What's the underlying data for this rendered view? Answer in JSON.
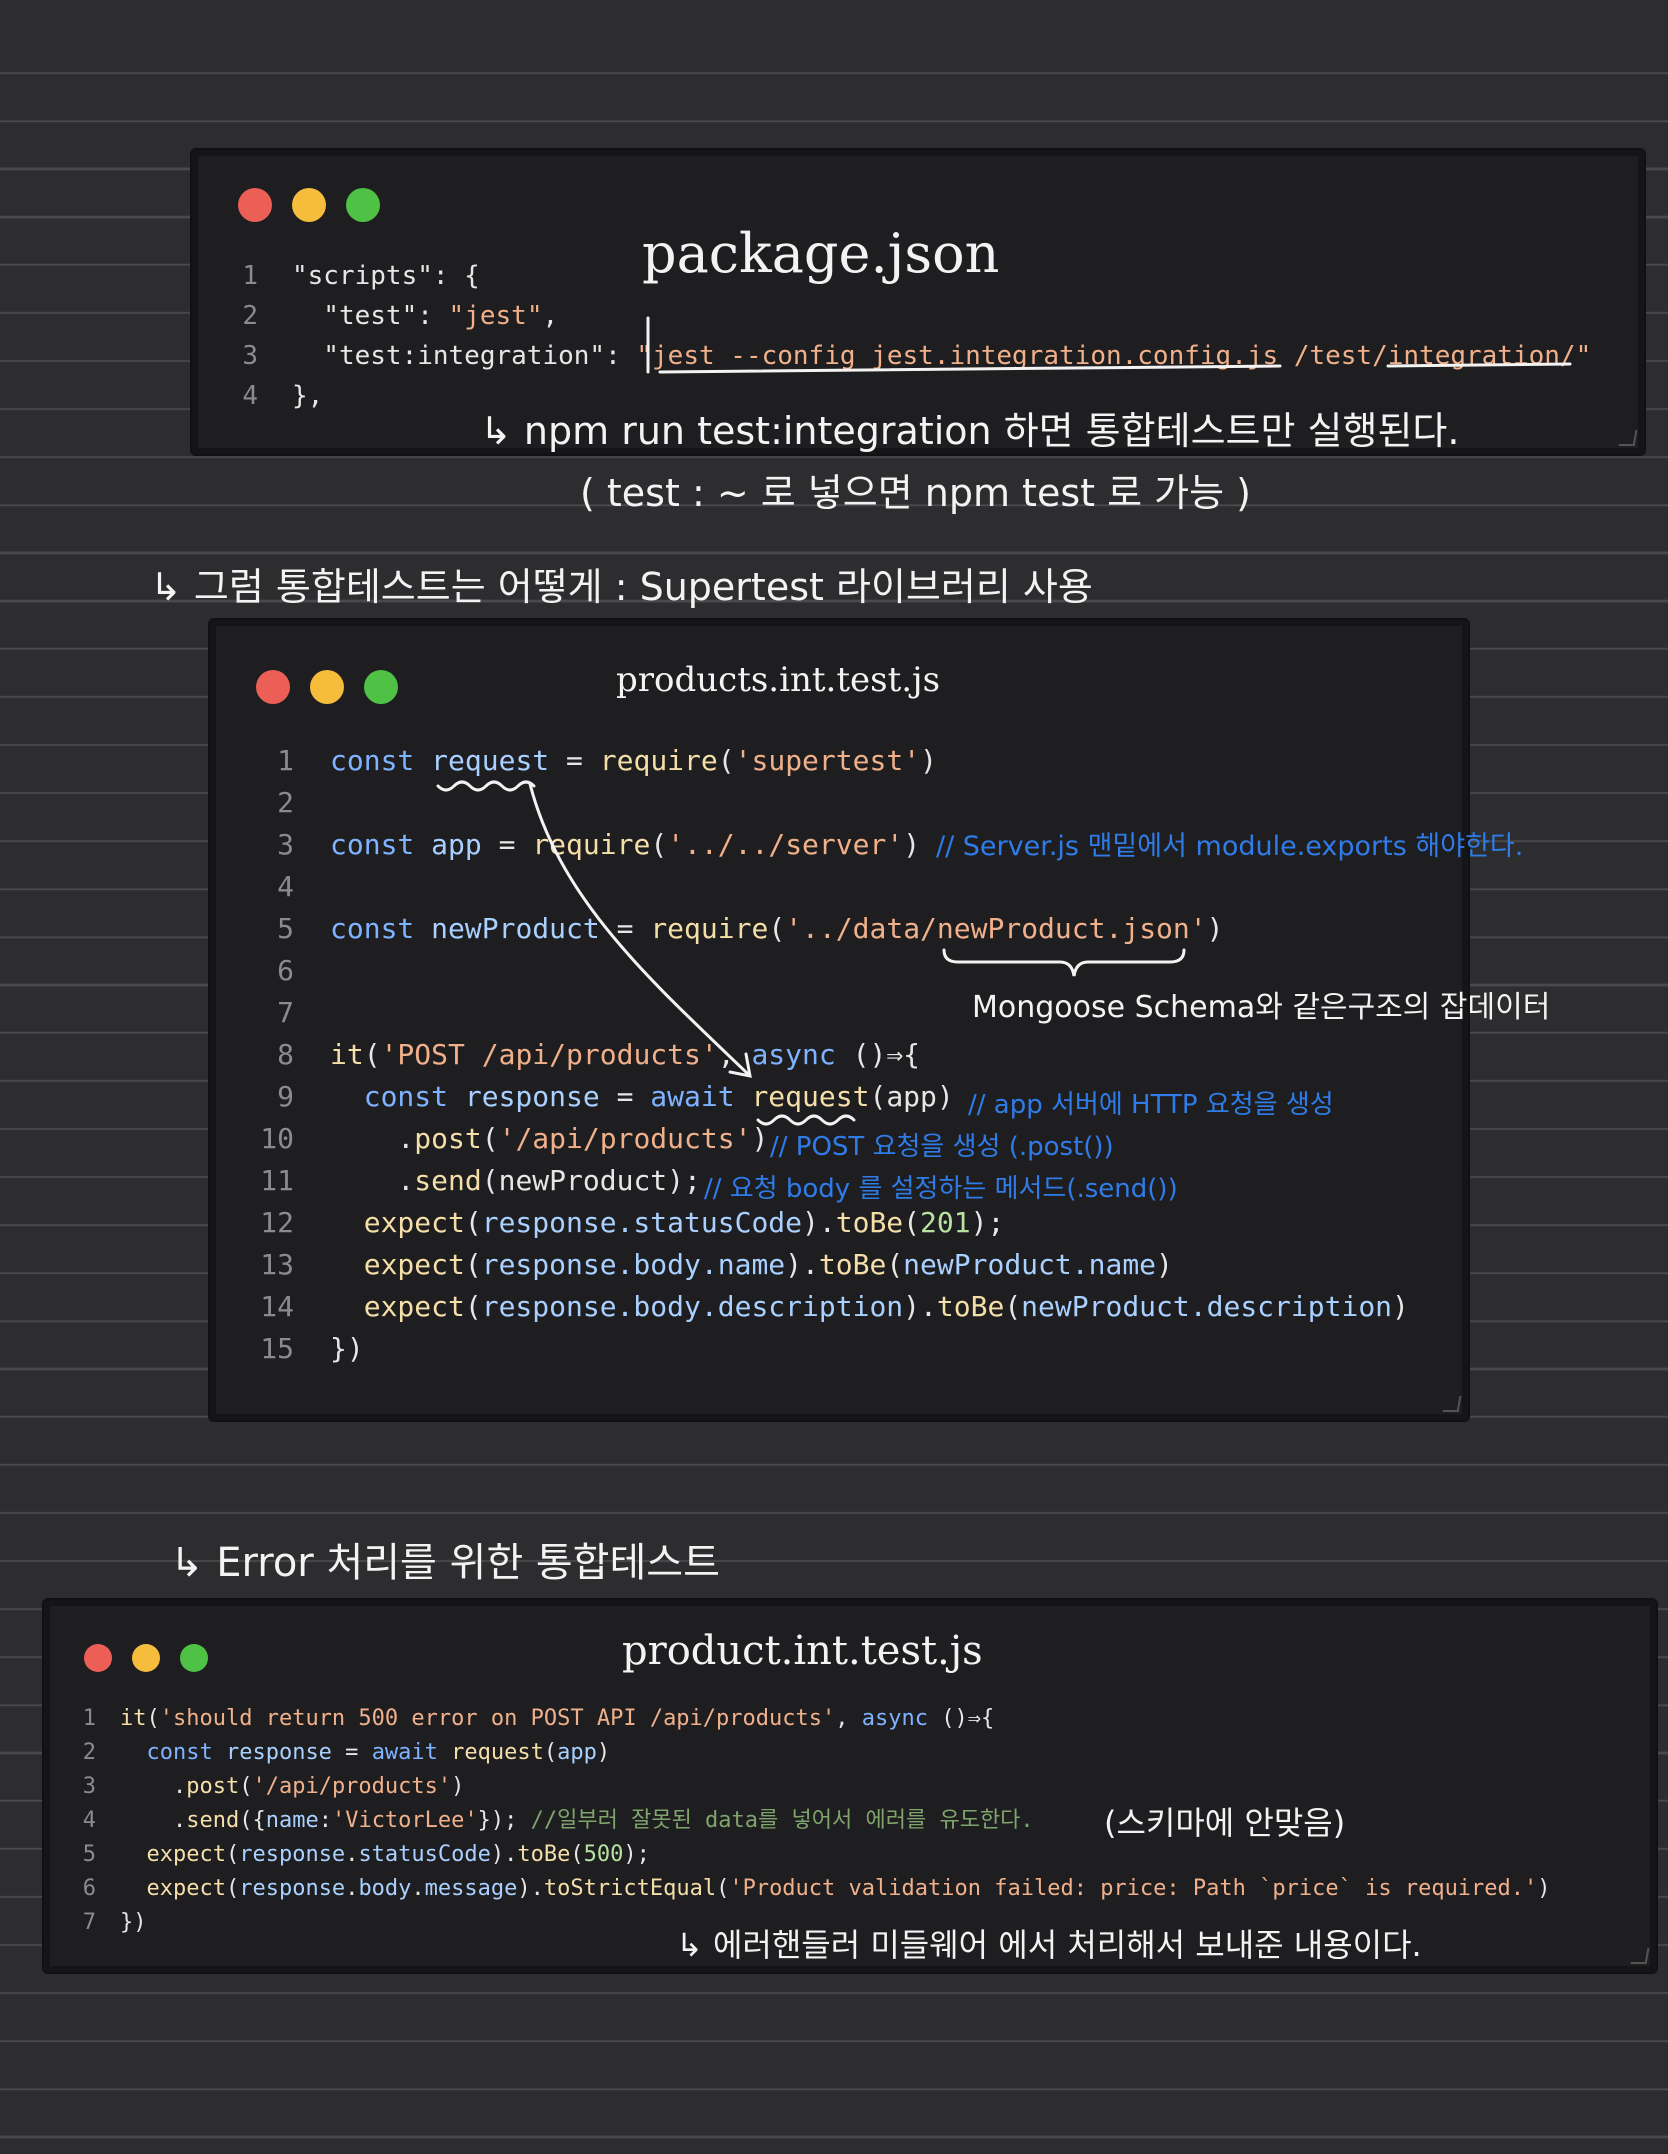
{
  "window1": {
    "title": "package.json",
    "lines": [
      {
        "n": "1",
        "parts": [
          [
            "pr",
            "\"scripts\": {"
          ]
        ]
      },
      {
        "n": "2",
        "parts": [
          [
            "pr",
            "  \"test\": "
          ],
          [
            "str",
            "\"jest\""
          ],
          [
            "pr",
            ","
          ]
        ]
      },
      {
        "n": "3",
        "parts": [
          [
            "pr",
            "  \"test:integration\": "
          ],
          [
            "str",
            "\"jest --config jest.integration.config.js /test/integration/\""
          ]
        ]
      },
      {
        "n": "4",
        "parts": [
          [
            "pr",
            "},"
          ]
        ]
      }
    ]
  },
  "note1": "↳ npm run test:integration   하면 통합테스트만 실행된다.",
  "note2": "( test : ~ 로 넣으면   npm test 로  가능 )",
  "note3": "↳  그럼 통합테스트는 어떻게  :  Supertest 라이브러리 사용",
  "window2": {
    "title": "products.int.test.js",
    "lines": [
      {
        "n": "1",
        "parts": [
          [
            "kw",
            "const "
          ],
          [
            "id",
            "request"
          ],
          [
            "pr",
            " = "
          ],
          [
            "fn",
            "require"
          ],
          [
            "pr",
            "("
          ],
          [
            "str",
            "'supertest'"
          ],
          [
            "pr",
            ")"
          ]
        ]
      },
      {
        "n": "2",
        "parts": []
      },
      {
        "n": "3",
        "parts": [
          [
            "kw",
            "const "
          ],
          [
            "id",
            "app"
          ],
          [
            "pr",
            " = "
          ],
          [
            "fn",
            "require"
          ],
          [
            "pr",
            "("
          ],
          [
            "str",
            "'../../server'"
          ],
          [
            "pr",
            ")"
          ]
        ]
      },
      {
        "n": "4",
        "parts": []
      },
      {
        "n": "5",
        "parts": [
          [
            "kw",
            "const "
          ],
          [
            "id",
            "newProduct"
          ],
          [
            "pr",
            " = "
          ],
          [
            "fn",
            "require"
          ],
          [
            "pr",
            "("
          ],
          [
            "str",
            "'../data/newProduct.json'"
          ],
          [
            "pr",
            ")"
          ]
        ]
      },
      {
        "n": "6",
        "parts": []
      },
      {
        "n": "7",
        "parts": []
      },
      {
        "n": "8",
        "parts": [
          [
            "fn",
            "it"
          ],
          [
            "pr",
            "("
          ],
          [
            "str",
            "'POST /api/products'"
          ],
          [
            "pr",
            ", "
          ],
          [
            "kw",
            "async "
          ],
          [
            "pr",
            "()⇒{"
          ]
        ]
      },
      {
        "n": "9",
        "parts": [
          [
            "kw",
            "  const "
          ],
          [
            "id",
            "response"
          ],
          [
            "pr",
            " = "
          ],
          [
            "kw",
            "await "
          ],
          [
            "fn",
            "request"
          ],
          [
            "pr",
            "(app)"
          ]
        ]
      },
      {
        "n": "10",
        "parts": [
          [
            "pr",
            "    ."
          ],
          [
            "fn",
            "post"
          ],
          [
            "pr",
            "("
          ],
          [
            "str",
            "'/api/products'"
          ],
          [
            "pr",
            ")"
          ]
        ]
      },
      {
        "n": "11",
        "parts": [
          [
            "pr",
            "    ."
          ],
          [
            "fn",
            "send"
          ],
          [
            "pr",
            "(newProduct);"
          ]
        ]
      },
      {
        "n": "12",
        "parts": [
          [
            "fn",
            "  expect"
          ],
          [
            "pr",
            "("
          ],
          [
            "id",
            "response.statusCode"
          ],
          [
            "pr",
            ")."
          ],
          [
            "fn",
            "toBe"
          ],
          [
            "pr",
            "("
          ],
          [
            "num",
            "201"
          ],
          [
            "pr",
            ");"
          ]
        ]
      },
      {
        "n": "13",
        "parts": [
          [
            "fn",
            "  expect"
          ],
          [
            "pr",
            "("
          ],
          [
            "id",
            "response.body.name"
          ],
          [
            "pr",
            ")."
          ],
          [
            "fn",
            "toBe"
          ],
          [
            "pr",
            "("
          ],
          [
            "id",
            "newProduct.name"
          ],
          [
            "pr",
            ")"
          ]
        ]
      },
      {
        "n": "14",
        "parts": [
          [
            "fn",
            "  expect"
          ],
          [
            "pr",
            "("
          ],
          [
            "id",
            "response.body.description"
          ],
          [
            "pr",
            ")."
          ],
          [
            "fn",
            "toBe"
          ],
          [
            "pr",
            "("
          ],
          [
            "id",
            "newProduct.description"
          ],
          [
            "pr",
            ")"
          ]
        ]
      },
      {
        "n": "15",
        "parts": [
          [
            "pr",
            "})"
          ]
        ]
      }
    ]
  },
  "comment_line3": "// Server.js 맨밑에서  module.exports 해야한다.",
  "note_schema": "Mongoose Schema와  같은구조의 잡데이터",
  "comment_line9": "// app 서버에  HTTP 요청을 생성",
  "comment_line10": "// POST 요청을 생성 (.post())",
  "comment_line11": "// 요청 body 를 설정하는 메서드(.send())",
  "note4": "↳ Error  처리를  위한   통합테스트",
  "window3": {
    "title": "product.int.test.js",
    "lines": [
      {
        "n": "1",
        "parts": [
          [
            "fn",
            "it"
          ],
          [
            "pr",
            "("
          ],
          [
            "str",
            "'should return 500 error on POST API /api/products'"
          ],
          [
            "pr",
            ", "
          ],
          [
            "kw",
            "async "
          ],
          [
            "pr",
            "()⇒{"
          ]
        ]
      },
      {
        "n": "2",
        "parts": [
          [
            "kw",
            "  const "
          ],
          [
            "id",
            "response"
          ],
          [
            "pr",
            " = "
          ],
          [
            "kw",
            "await "
          ],
          [
            "fn",
            "request"
          ],
          [
            "pr",
            "("
          ],
          [
            "id",
            "app"
          ],
          [
            "pr",
            ")"
          ]
        ]
      },
      {
        "n": "3",
        "parts": [
          [
            "pr",
            "    ."
          ],
          [
            "fn",
            "post"
          ],
          [
            "pr",
            "("
          ],
          [
            "str",
            "'/api/products'"
          ],
          [
            "pr",
            ")"
          ]
        ]
      },
      {
        "n": "4",
        "parts": [
          [
            "pr",
            "    ."
          ],
          [
            "fn",
            "send"
          ],
          [
            "pr",
            "({"
          ],
          [
            "id",
            "name"
          ],
          [
            "pr",
            ":"
          ],
          [
            "str",
            "'VictorLee'"
          ],
          [
            "pr",
            "}); "
          ],
          [
            "cmt",
            "//일부러 잘못된 data를 넣어서 에러를 유도한다."
          ]
        ]
      },
      {
        "n": "5",
        "parts": [
          [
            "fn",
            "  expect"
          ],
          [
            "pr",
            "("
          ],
          [
            "id",
            "response"
          ],
          [
            "pr",
            "."
          ],
          [
            "id",
            "statusCode"
          ],
          [
            "pr",
            ")."
          ],
          [
            "fn",
            "toBe"
          ],
          [
            "pr",
            "("
          ],
          [
            "num",
            "500"
          ],
          [
            "pr",
            ");"
          ]
        ]
      },
      {
        "n": "6",
        "parts": [
          [
            "fn",
            "  expect"
          ],
          [
            "pr",
            "("
          ],
          [
            "id",
            "response"
          ],
          [
            "pr",
            "."
          ],
          [
            "id",
            "body"
          ],
          [
            "pr",
            "."
          ],
          [
            "id",
            "message"
          ],
          [
            "pr",
            ")."
          ],
          [
            "fn",
            "toStrictEqual"
          ],
          [
            "pr",
            "("
          ],
          [
            "str",
            "'Product validation failed: price: Path `price` is required.'"
          ],
          [
            "pr",
            ")"
          ]
        ]
      },
      {
        "n": "7",
        "parts": [
          [
            "pr",
            "})"
          ]
        ]
      }
    ]
  },
  "note_schema_mismatch": "(스키마에  안맞음)",
  "note5": "↳ 에러핸들러  미들웨어 에서  처리해서 보내준 내용이다.",
  "colors": {
    "background": "#2d2d2f",
    "window": "#1e1e21",
    "red_dot": "#ec5f57",
    "yellow_dot": "#f5bd3b",
    "green_dot": "#4fc246",
    "handwriting_blue": "#2f7ce8"
  }
}
